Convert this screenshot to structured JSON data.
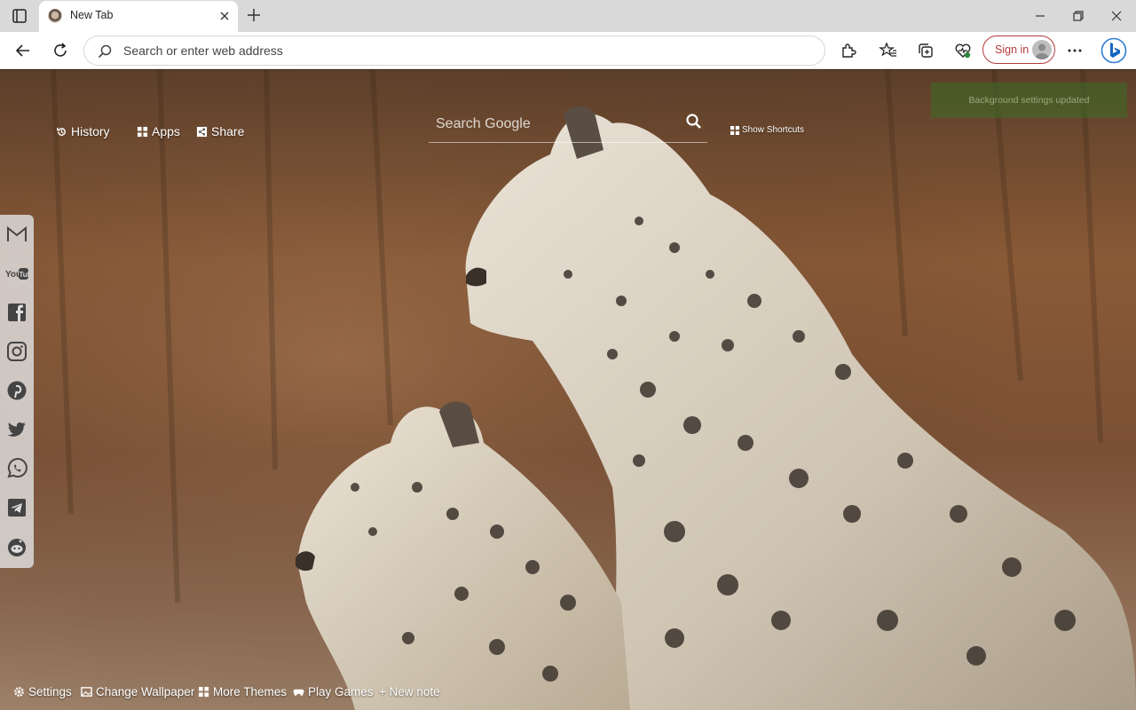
{
  "browser": {
    "tab": {
      "title": "New Tab"
    },
    "address_bar": {
      "placeholder": "Search or enter web address"
    },
    "signin_label": "Sign in"
  },
  "newtab": {
    "top_links": {
      "history": "History",
      "apps": "Apps",
      "share": "Share"
    },
    "search": {
      "placeholder": "Search Google"
    },
    "show_shortcuts": "Show Shortcuts",
    "toast": "Background settings updated",
    "social": [
      "gmail-icon",
      "youtube-icon",
      "facebook-icon",
      "instagram-icon",
      "pinterest-icon",
      "twitter-icon",
      "whatsapp-icon",
      "telegram-icon",
      "reddit-icon"
    ],
    "bottom_links": {
      "settings": "Settings",
      "change_wallpaper": "Change Wallpaper",
      "more_themes": "More Themes",
      "play_games": "Play Games",
      "new_note": "+ New note"
    }
  },
  "colors": {
    "signin_accent": "#b33a3a",
    "toast_bg": "#3a6e26"
  }
}
